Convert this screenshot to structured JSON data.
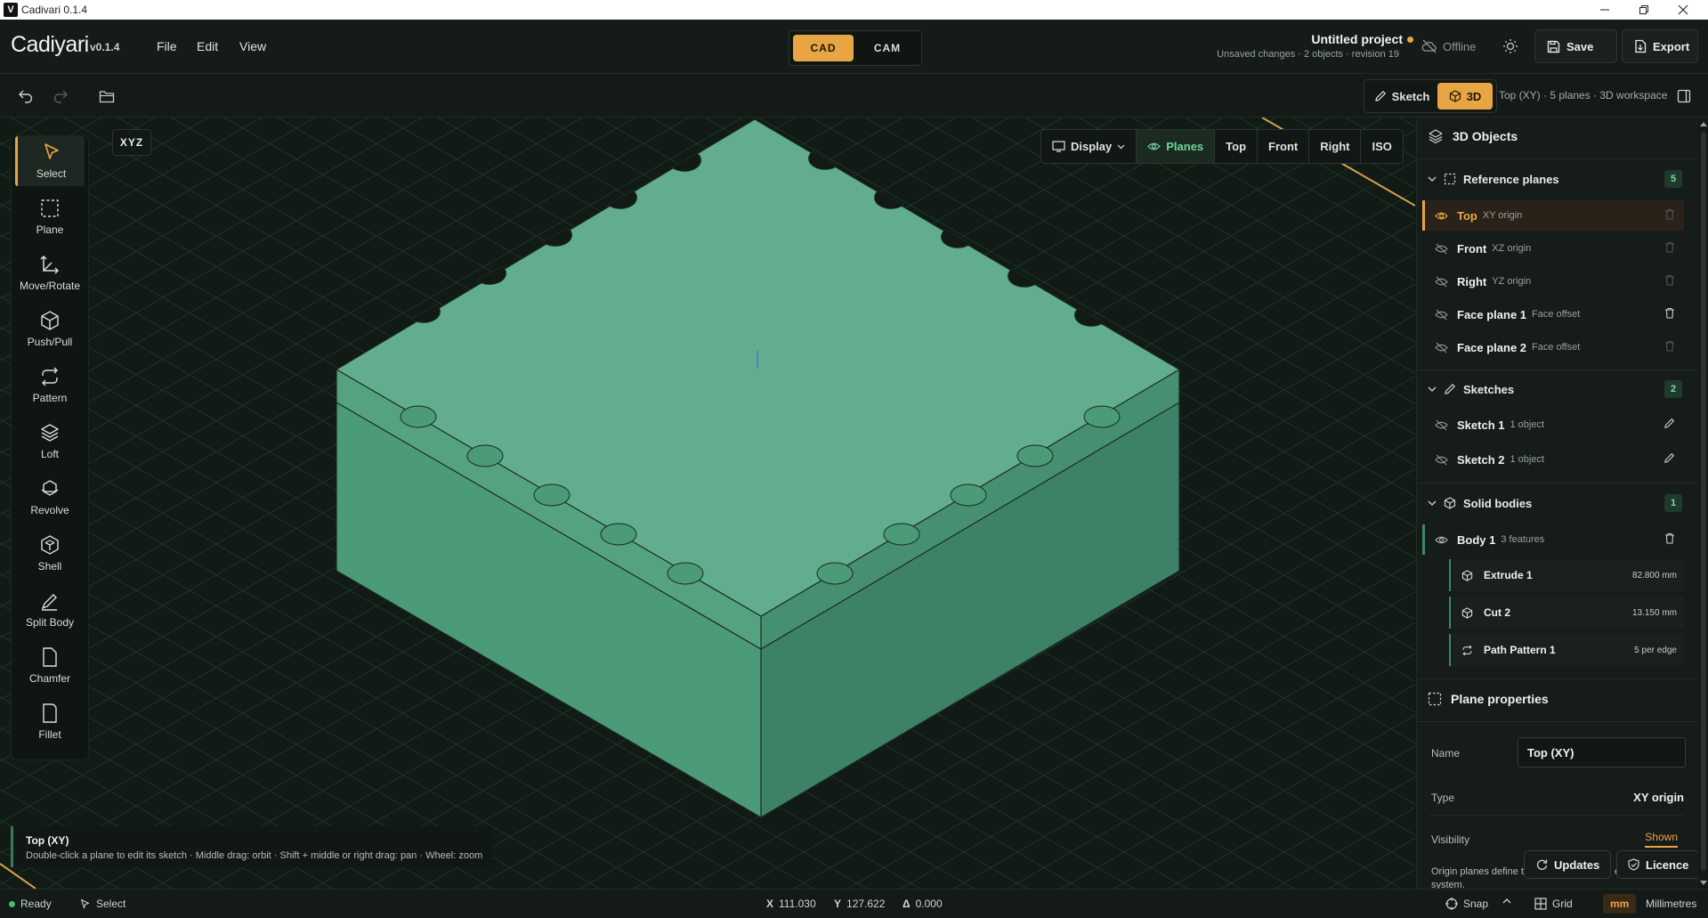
{
  "window": {
    "title": "Cadivari 0.1.4",
    "logo": "V"
  },
  "app": {
    "name": "Cadiyari",
    "version": "v0.1.4"
  },
  "menu": [
    "File",
    "Edit",
    "View"
  ],
  "mode": {
    "cad": "CAD",
    "cam": "CAM",
    "active": "CAD"
  },
  "project": {
    "title": "Untitled project",
    "subtitle": "Unsaved changes · 2 objects · revision 19"
  },
  "header": {
    "offline": "Offline",
    "save": "Save",
    "export": "Export"
  },
  "viewmode": {
    "sketch": "Sketch",
    "threed": "3D",
    "workspace": "Top (XY) · 5 planes · 3D workspace"
  },
  "tools": [
    {
      "label": "Select",
      "icon": "cursor-icon"
    },
    {
      "label": "Plane",
      "icon": "plane-icon"
    },
    {
      "label": "Move/Rotate",
      "icon": "move-icon"
    },
    {
      "label": "Push/Pull",
      "icon": "cube-icon"
    },
    {
      "label": "Pattern",
      "icon": "pattern-icon"
    },
    {
      "label": "Loft",
      "icon": "layers-icon"
    },
    {
      "label": "Revolve",
      "icon": "revolve-icon"
    },
    {
      "label": "Shell",
      "icon": "shell-icon"
    },
    {
      "label": "Split Body",
      "icon": "split-icon"
    },
    {
      "label": "Chamfer",
      "icon": "chamfer-icon"
    },
    {
      "label": "Fillet",
      "icon": "fillet-icon"
    }
  ],
  "viewport": {
    "axis_badge": "XYZ",
    "display": "Display",
    "planes": "Planes",
    "views": [
      "Top",
      "Front",
      "Right",
      "ISO"
    ]
  },
  "hint": {
    "title": "Top (XY)",
    "text": "Double-click a plane to edit its sketch · Middle drag: orbit · Shift + middle or right drag: pan · Wheel: zoom"
  },
  "panel": {
    "title": "3D Objects",
    "ref_planes": {
      "label": "Reference planes",
      "count": "5"
    },
    "planes": [
      {
        "name": "Top",
        "sub": "XY origin"
      },
      {
        "name": "Front",
        "sub": "XZ origin"
      },
      {
        "name": "Right",
        "sub": "YZ origin"
      },
      {
        "name": "Face plane 1",
        "sub": "Face offset"
      },
      {
        "name": "Face plane 2",
        "sub": "Face offset"
      }
    ],
    "sketches": {
      "label": "Sketches",
      "count": "2"
    },
    "sketch_items": [
      {
        "name": "Sketch 1",
        "sub": "1 object"
      },
      {
        "name": "Sketch 2",
        "sub": "1 object"
      }
    ],
    "solids": {
      "label": "Solid bodies",
      "count": "1"
    },
    "body": {
      "name": "Body 1",
      "sub": "3 features"
    },
    "features": [
      {
        "name": "Extrude 1",
        "value": "82.800 mm"
      },
      {
        "name": "Cut 2",
        "value": "13.150 mm"
      },
      {
        "name": "Path Pattern 1",
        "value": "5 per edge"
      }
    ],
    "props": {
      "title": "Plane properties",
      "name_label": "Name",
      "name_value": "Top (XY)",
      "type_label": "Type",
      "type_value": "XY origin",
      "visibility_label": "Visibility",
      "visibility_value": "Shown",
      "note": "Origin planes define t",
      "note_tail": "el",
      "note2": "system."
    },
    "updates": "Updates",
    "licence": "Licence"
  },
  "status": {
    "ready": "Ready",
    "tool": "Select",
    "x_label": "X",
    "x": "111.030",
    "y_label": "Y",
    "y": "127.622",
    "d_label": "Δ",
    "d": "0.000",
    "snap": "Snap",
    "grid": "Grid",
    "units_short": "mm",
    "units": "Millimetres"
  },
  "colors": {
    "accent": "#e8a543",
    "model": "#5fa98a",
    "green": "#6fd3a0"
  }
}
